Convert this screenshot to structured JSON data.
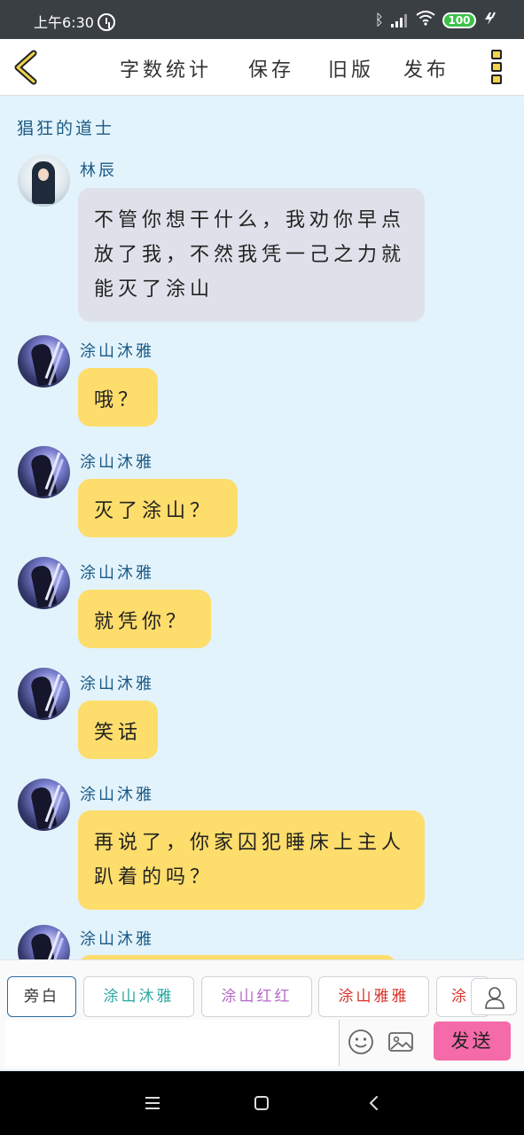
{
  "status_bar": {
    "time": "上午6:30",
    "battery": "100",
    "icons": [
      "alarm-icon",
      "bluetooth-icon",
      "signal-icon",
      "wifi-icon",
      "battery-icon",
      "charging-icon"
    ]
  },
  "toolbar": {
    "back_icon": "chevron-left-icon",
    "items": [
      "字数统计",
      "保存",
      "旧版",
      "发布"
    ],
    "more_icon": "more-vertical-icon"
  },
  "chat": {
    "title": "猖狂的道士",
    "messages": [
      {
        "sender": "林辰",
        "text": "不管你想干什么，我劝你早点放了我，不然我凭一己之力就能灭了涂山",
        "style": "grey"
      },
      {
        "sender": "涂山沐雅",
        "text": "哦？",
        "style": "yellow"
      },
      {
        "sender": "涂山沐雅",
        "text": "灭了涂山？",
        "style": "yellow"
      },
      {
        "sender": "涂山沐雅",
        "text": "就凭你？",
        "style": "yellow"
      },
      {
        "sender": "涂山沐雅",
        "text": "笑话",
        "style": "yellow"
      },
      {
        "sender": "涂山沐雅",
        "text": "再说了，你家囚犯睡床上主人趴着的吗？",
        "style": "yellow"
      },
      {
        "sender": "涂山沐雅",
        "text": "",
        "style": "yellow"
      }
    ]
  },
  "roles": [
    {
      "label": "旁白",
      "color": "#333333"
    },
    {
      "label": "涂山沐雅",
      "color": "#27a8a0"
    },
    {
      "label": "涂山红红",
      "color": "#b46ac8"
    },
    {
      "label": "涂山雅雅",
      "color": "#d9342b"
    },
    {
      "label": "涂",
      "color": "#d9342b"
    }
  ],
  "input": {
    "placeholder": "",
    "value": "",
    "send_label": "发送"
  },
  "colors": {
    "chat_bg": "#e3f3fc",
    "name_color": "#1b5a85",
    "grey_bubble": "#dfe1ea",
    "yellow_bubble": "#fddd6b",
    "send_button": "#f56aa8"
  }
}
